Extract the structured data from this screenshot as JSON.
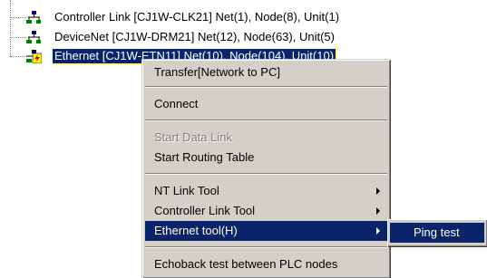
{
  "tree": {
    "nodes": [
      {
        "label": "Controller Link [CJ1W-CLK21] Net(1), Node(8), Unit(1)",
        "icon": "network-node-icon",
        "selected": false
      },
      {
        "label": "DeviceNet [CJ1W-DRM21] Net(12), Node(63), Unit(5)",
        "icon": "network-node-icon",
        "selected": false
      },
      {
        "label": "Ethernet [CJ1W-ETN11] Net(10), Node(104), Unit(10)",
        "icon": "ethernet-node-icon",
        "selected": true
      }
    ]
  },
  "context_menu": {
    "transfer": "Transfer[Network to PC]",
    "connect": "Connect",
    "start_data_link": "Start Data Link",
    "start_routing_table": "Start Routing Table",
    "nt_link_tool": "NT Link Tool",
    "controller_link_tool": "Controller Link Tool",
    "ethernet_tool": "Ethernet tool(H)",
    "echoback_test": "Echoback test between PLC nodes"
  },
  "submenu": {
    "ping_test": "Ping test"
  },
  "colors": {
    "highlight": "#0a246a",
    "menu_face": "#d4d0c8",
    "disabled_text": "#808080"
  }
}
